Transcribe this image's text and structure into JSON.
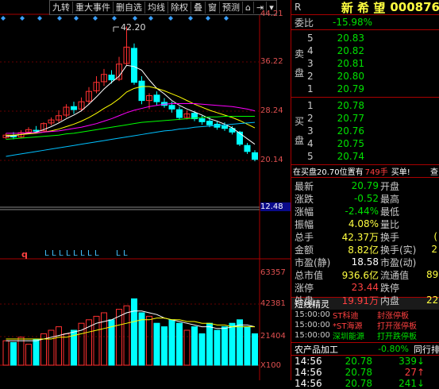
{
  "toolbar": {
    "items": [
      "九转",
      "重大事件",
      "删自选",
      "均线",
      "除权",
      "叠",
      "窗",
      "预测"
    ]
  },
  "price_axis": {
    "ticks": [
      "44.21",
      "36.22",
      "28.24",
      "20.14"
    ],
    "current": "12.48",
    "high_marker": "42.20"
  },
  "volume_axis": {
    "ticks": [
      "63357",
      "42381",
      "21404"
    ],
    "unit": "X100"
  },
  "signals": {
    "q_label": "q",
    "l_marks": [
      "L",
      "L",
      "L",
      "L",
      "L",
      "L",
      "L",
      "L",
      "L",
      "L"
    ]
  },
  "stock": {
    "r_label": "R",
    "name": "新 希 望",
    "code": "000876"
  },
  "order_book": {
    "weibi_label": "委比",
    "weibi_value": "-15.98%",
    "sell_label": "卖盘",
    "buy_label": "买盘",
    "sell": [
      {
        "level": "5",
        "price": "20.83"
      },
      {
        "level": "4",
        "price": "20.82"
      },
      {
        "level": "3",
        "price": "20.81"
      },
      {
        "level": "2",
        "price": "20.80"
      },
      {
        "level": "1",
        "price": "20.79"
      }
    ],
    "buy": [
      {
        "level": "1",
        "price": "20.78"
      },
      {
        "level": "2",
        "price": "20.77"
      },
      {
        "level": "3",
        "price": "20.76"
      },
      {
        "level": "4",
        "price": "20.75"
      },
      {
        "level": "5",
        "price": "20.74"
      }
    ]
  },
  "banner": {
    "text": "在买盘20.70位置有",
    "qty": "749手",
    "action": "买单!",
    "extra": "查"
  },
  "quote": {
    "rows": [
      {
        "l": "最新",
        "v": "20.79",
        "r": "开盘",
        "rv": ""
      },
      {
        "l": "涨跌",
        "v": "-0.52",
        "r": "最高",
        "rv": ""
      },
      {
        "l": "涨幅",
        "v": "-2.44%",
        "r": "最低",
        "rv": ""
      },
      {
        "l": "振幅",
        "v": "4.08%",
        "r": "量比",
        "rv": ""
      },
      {
        "l": "总手",
        "v": "42.37万",
        "r": "换手",
        "rv": "("
      },
      {
        "l": "金额",
        "v": "8.82亿",
        "r": "换手(实)",
        "rv": "2"
      },
      {
        "l": "市盈(静)",
        "v": "18.58",
        "r": "市盈(动)",
        "rv": ""
      },
      {
        "l": "总市值",
        "v": "936.6亿",
        "r": "流通值",
        "rv": "89"
      },
      {
        "l": "涨停",
        "v": "23.44",
        "r": "跌停",
        "rv": ""
      },
      {
        "l": "外盘",
        "v": "19.91万",
        "r": "内盘",
        "rv": "22"
      }
    ]
  },
  "short_wizard": {
    "title": "短线精灵",
    "items": [
      {
        "time": "15:00:00",
        "name": "ST科迪",
        "event": "封涨停板"
      },
      {
        "time": "15:00:00",
        "name": "*ST海源",
        "event": "打开涨停板"
      },
      {
        "time": "15:00:00",
        "name": "深圳能源",
        "event": "打开跌停板"
      }
    ]
  },
  "sector": {
    "name": "农产品加工",
    "change": "-0.80%",
    "rank": "同行排"
  },
  "ticks": [
    {
      "time": "14:56",
      "price": "20.78",
      "vol": "339",
      "dir": "down"
    },
    {
      "time": "14:56",
      "price": "20.78",
      "vol": "27",
      "dir": "up"
    },
    {
      "time": "14:56",
      "price": "20.78",
      "vol": "241",
      "dir": "down"
    }
  ],
  "colors": {
    "up": "#ff3030",
    "down": "#00ffff",
    "ma5": "#ffffff",
    "ma10": "#ffff00",
    "ma20": "#ff00ff",
    "ma60": "#00ff00",
    "ma120": "#00c0ff",
    "border": "#aa0000"
  }
}
